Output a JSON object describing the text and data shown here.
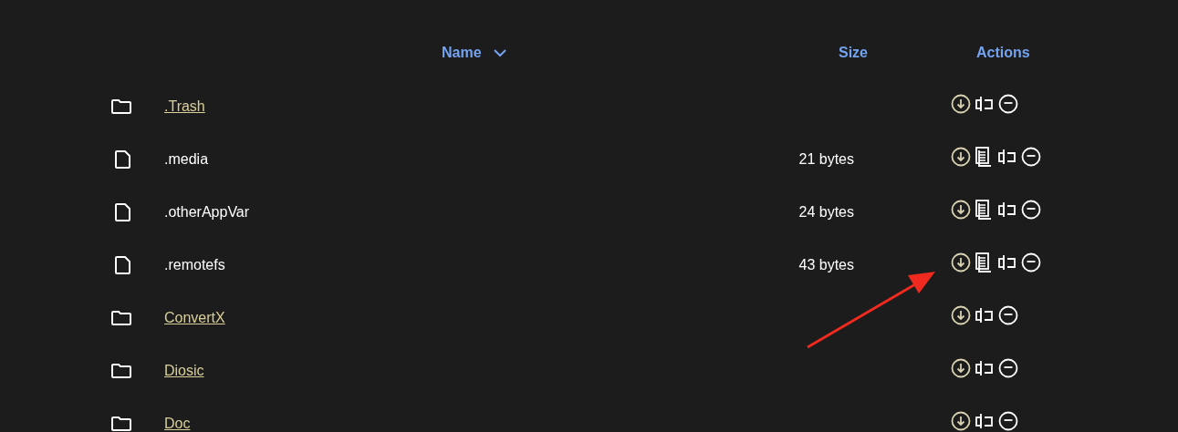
{
  "columns": [
    {
      "label": "Name",
      "sorted": true
    },
    {
      "label": "Size"
    },
    {
      "label": "Actions"
    }
  ],
  "rows": [
    {
      "kind": "folder",
      "name": ".Trash",
      "actions": [
        {
          "kind": "download"
        },
        {
          "kind": "move"
        },
        {
          "kind": "delete"
        }
      ]
    },
    {
      "kind": "file",
      "name": ".media",
      "size": "21 bytes",
      "actions": [
        {
          "kind": "download"
        },
        {
          "kind": "copy"
        },
        {
          "kind": "move"
        },
        {
          "kind": "delete"
        }
      ]
    },
    {
      "kind": "file",
      "name": ".otherAppVar",
      "size": "24 bytes",
      "actions": [
        {
          "kind": "download"
        },
        {
          "kind": "copy"
        },
        {
          "kind": "move"
        },
        {
          "kind": "delete"
        }
      ]
    },
    {
      "kind": "file",
      "name": ".remotefs",
      "size": "43 bytes",
      "actions": [
        {
          "kind": "download"
        },
        {
          "kind": "copy"
        },
        {
          "kind": "move"
        },
        {
          "kind": "delete"
        }
      ]
    },
    {
      "kind": "folder",
      "name": "ConvertX",
      "actions": [
        {
          "kind": "download"
        },
        {
          "kind": "move"
        },
        {
          "kind": "delete"
        }
      ]
    },
    {
      "kind": "folder",
      "name": "Diosic",
      "actions": [
        {
          "kind": "download"
        },
        {
          "kind": "move"
        },
        {
          "kind": "delete"
        }
      ]
    },
    {
      "kind": "folder",
      "name": "Doc",
      "actions": [
        {
          "kind": "download"
        },
        {
          "kind": "move"
        },
        {
          "kind": "delete"
        }
      ]
    }
  ],
  "annotation": {
    "kind": "arrow"
  }
}
